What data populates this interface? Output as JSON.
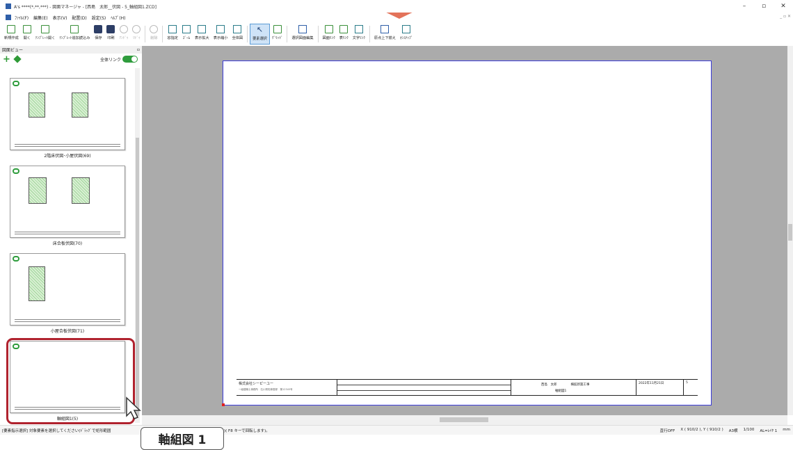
{
  "window": {
    "title": "A's ****(*,**,***) - 図面マネージャ - [西島　太郎__伏図 - 5_軸組図1.ZCD]",
    "controls": [
      "–",
      "▫",
      "✕"
    ]
  },
  "menu": {
    "items": [
      "ﾌｧｲﾙ(F)",
      "編集(E)",
      "表示(V)",
      "配置(D)",
      "設定(S)",
      "ﾍﾙﾌﾟ(H)"
    ],
    "mdi_controls": "_ ▫ ✕"
  },
  "toolbar": {
    "buttons": [
      {
        "label": "新規作成",
        "icon": "new-file-icon"
      },
      {
        "label": "開く",
        "icon": "open-icon"
      },
      {
        "label": "ﾃﾝﾌﾟﾚｰﾄ開く",
        "icon": "template-open-icon"
      },
      {
        "label": "ﾃﾝﾌﾟﾚｰﾄ追加読込み",
        "icon": "template-add-icon"
      },
      {
        "label": "保存",
        "icon": "save-icon"
      },
      {
        "label": "印刷",
        "icon": "print-icon"
      },
      {
        "label": "ｱﾝﾄﾞｩ",
        "icon": "undo-icon"
      },
      {
        "label": "ﾘﾄﾞｩ",
        "icon": "redo-icon"
      },
      {
        "label": "削除",
        "icon": "delete-icon"
      },
      {
        "label": "窓指定",
        "icon": "window-select-icon"
      },
      {
        "label": "ｽﾞｰﾑ",
        "icon": "zoom-icon"
      },
      {
        "label": "表示拡大",
        "icon": "zoom-in-icon"
      },
      {
        "label": "表示縮小",
        "icon": "zoom-out-icon"
      },
      {
        "label": "全体図",
        "icon": "fit-all-icon"
      },
      {
        "label": "要素選択",
        "icon": "select-cursor-icon"
      },
      {
        "label": "ｸﾞﾘｯﾄﾞ",
        "icon": "grid-icon"
      },
      {
        "label": "選択図面編集",
        "icon": "edit-drawing-icon"
      },
      {
        "label": "図面ﾘﾝｸ",
        "icon": "drawing-link-icon"
      },
      {
        "label": "表ﾘﾝｸ",
        "icon": "table-link-icon"
      },
      {
        "label": "文字ﾘﾝｸ",
        "icon": "text-link-icon"
      },
      {
        "label": "原点上下揃え",
        "icon": "align-origin-icon"
      },
      {
        "label": "ｵﾝｽﾅｯﾌﾟ",
        "icon": "snap-icon"
      }
    ]
  },
  "pane": {
    "title": "図面ビュー",
    "pin": "▫",
    "link_all_label": "全体リンク",
    "thumbnails": [
      {
        "caption": "2階床伏図･小屋伏図(69)"
      },
      {
        "caption": "床合板伏図(70)"
      },
      {
        "caption": "小屋合板伏図(71)"
      },
      {
        "caption": "軸組図1(5)"
      }
    ]
  },
  "sheet": {
    "company": "株式会社シーピーユー",
    "company_sub": "一級建築士事務所　石川県知事登録　第12345号",
    "owner": "西島　太郎",
    "project": "横館新築工事",
    "date": "2022年11月21日",
    "drawing_name": "軸組図1",
    "page_no": "5"
  },
  "status": {
    "left": "[要素指示選択] 対象要素を選択してください(ﾄﾞﾗｯｸﾞで矩形範囲",
    "mid": ")( F8 キーで回転します)。",
    "items": [
      "直行OFF",
      "X ( 910/2 ), Y ( 910/2 )",
      "A3横",
      "1/100",
      "AL=ﾚｲﾔ 1",
      "mm"
    ]
  },
  "callout": {
    "label": "軸組図 1"
  }
}
